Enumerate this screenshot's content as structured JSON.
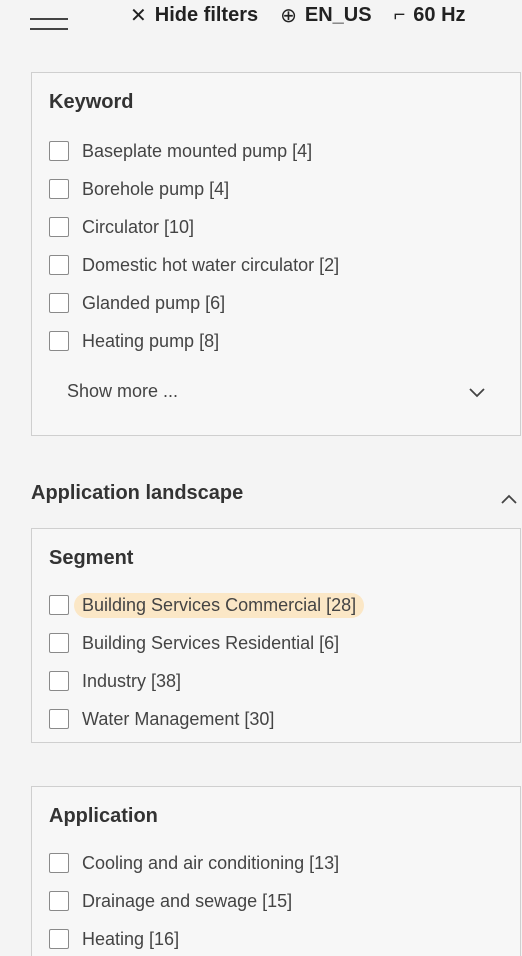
{
  "topbar": {
    "hide_filters_icon": "close-icon",
    "hide_filters_label": "Hide filters",
    "language_icon": "globe-icon",
    "language_label": "EN_US",
    "frequency_icon": "frequency-icon",
    "frequency_label": "60 Hz"
  },
  "keyword_panel": {
    "title": "Keyword",
    "options": [
      "Baseplate mounted pump [4]",
      "Borehole pump [4]",
      "Circulator [10]",
      "Domestic hot water circulator [2]",
      "Glanded pump [6]",
      "Heating pump [8]"
    ],
    "show_more_label": "Show more ..."
  },
  "application_landscape": {
    "title": "Application landscape"
  },
  "segment_panel": {
    "title": "Segment",
    "options": [
      "Building Services Commercial [28]",
      "Building Services Residential [6]",
      "Industry [38]",
      "Water Management [30]"
    ]
  },
  "application_panel": {
    "title": "Application",
    "options": [
      "Cooling and air conditioning [13]",
      "Drainage and sewage [15]",
      "Heating [16]"
    ]
  },
  "colors": {
    "highlight": "#fbe7c6",
    "border": "#cfcfcf",
    "background": "#f4f4f4"
  }
}
